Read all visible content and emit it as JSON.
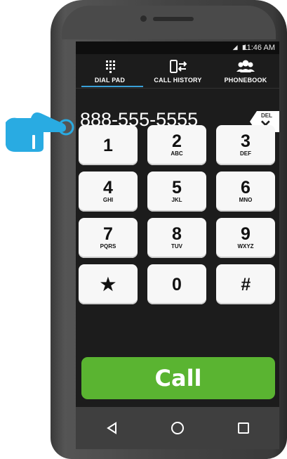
{
  "status_bar": {
    "time": "11:46 AM"
  },
  "tabs": [
    {
      "label": "DIAL PAD",
      "icon": "dialpad-icon",
      "active": true
    },
    {
      "label": "CALL HISTORY",
      "icon": "call-history-icon",
      "active": false
    },
    {
      "label": "PHONEBOOK",
      "icon": "phonebook-icon",
      "active": false
    }
  ],
  "dialed_number": "888-555-5555",
  "delete_button": {
    "label": "DEL",
    "symbol": "✕"
  },
  "keys": [
    {
      "digit": "1",
      "letters": ""
    },
    {
      "digit": "2",
      "letters": "ABC"
    },
    {
      "digit": "3",
      "letters": "DEF"
    },
    {
      "digit": "4",
      "letters": "GHI"
    },
    {
      "digit": "5",
      "letters": "JKL"
    },
    {
      "digit": "6",
      "letters": "MNO"
    },
    {
      "digit": "7",
      "letters": "PQRS"
    },
    {
      "digit": "8",
      "letters": "TUV"
    },
    {
      "digit": "9",
      "letters": "WXYZ"
    },
    {
      "digit": "★",
      "letters": ""
    },
    {
      "digit": "0",
      "letters": ""
    },
    {
      "digit": "#",
      "letters": ""
    }
  ],
  "call_button": {
    "label": "Call",
    "color": "#5ab431"
  },
  "nav_buttons": [
    "back-icon",
    "home-icon",
    "recents-icon"
  ],
  "colors": {
    "accent": "#3aa0d8",
    "pointer_hand": "#29abe2"
  }
}
